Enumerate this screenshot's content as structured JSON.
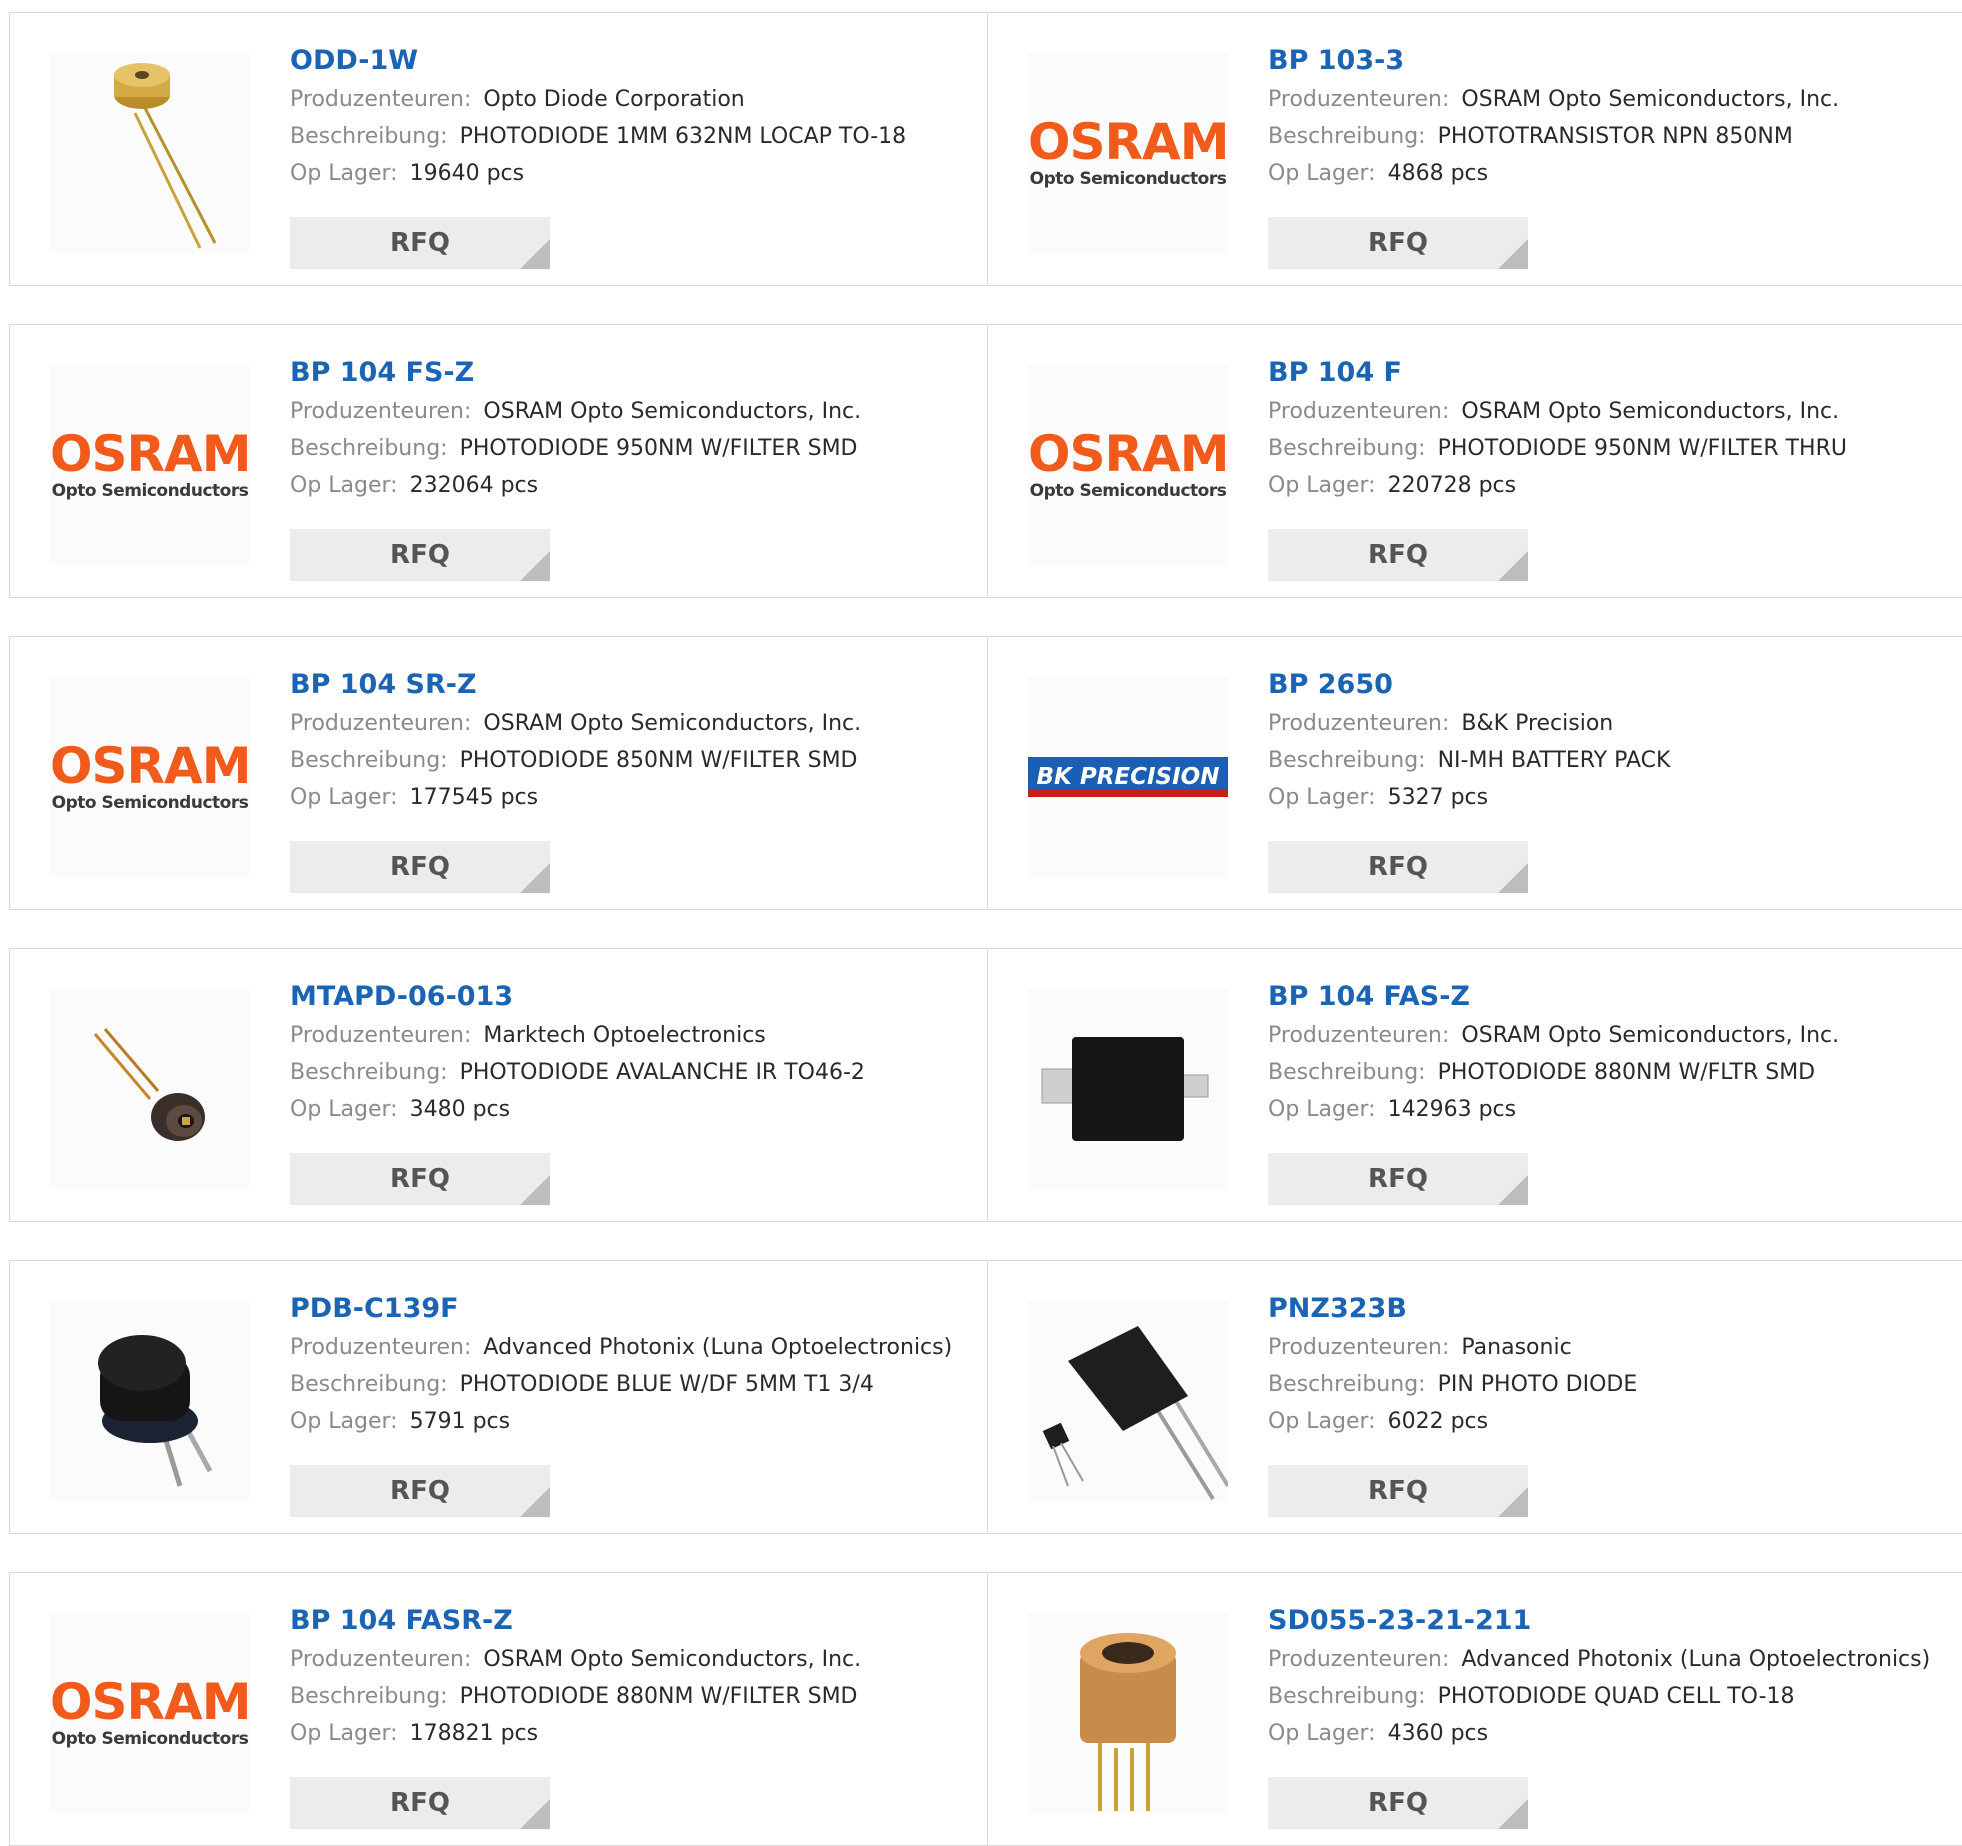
{
  "labels": {
    "manufacturer": "Produzenteuren:",
    "description": "Beschreibung:",
    "stock": "Op Lager:",
    "rfq": "RFQ"
  },
  "colors": {
    "product_link": "#1b64b3",
    "osram_orange": "#f05a1a",
    "rfq_bg": "#ececec"
  },
  "logos": {
    "osram_big": "OSRAM",
    "osram_small": "Opto Semiconductors",
    "bk": "BK PRECISION"
  },
  "products": [
    {
      "name": "ODD-1W",
      "manufacturer": "Opto Diode Corporation",
      "description": "PHOTODIODE 1MM 632NM LOCAP TO-18",
      "stock": "19640 pcs",
      "image": "to18-gold-photodiode"
    },
    {
      "name": "BP 103-3",
      "manufacturer": "OSRAM Opto Semiconductors, Inc.",
      "description": "PHOTOTRANSISTOR NPN 850NM",
      "stock": "4868 pcs",
      "image": "osram-logo"
    },
    {
      "name": "BP 104 FS-Z",
      "manufacturer": "OSRAM Opto Semiconductors, Inc.",
      "description": "PHOTODIODE 950NM W/FILTER SMD",
      "stock": "232064 pcs",
      "image": "osram-logo"
    },
    {
      "name": "BP 104 F",
      "manufacturer": "OSRAM Opto Semiconductors, Inc.",
      "description": "PHOTODIODE 950NM W/FILTER THRU",
      "stock": "220728 pcs",
      "image": "osram-logo"
    },
    {
      "name": "BP 104 SR-Z",
      "manufacturer": "OSRAM Opto Semiconductors, Inc.",
      "description": "PHOTODIODE 850NM W/FILTER SMD",
      "stock": "177545 pcs",
      "image": "osram-logo"
    },
    {
      "name": "BP 2650",
      "manufacturer": "B&K Precision",
      "description": "NI-MH BATTERY PACK",
      "stock": "5327 pcs",
      "image": "bk-precision-logo"
    },
    {
      "name": "MTAPD-06-013",
      "manufacturer": "Marktech Optoelectronics",
      "description": "PHOTODIODE AVALANCHE IR TO46-2",
      "stock": "3480 pcs",
      "image": "to46-photodiode"
    },
    {
      "name": "BP 104 FAS-Z",
      "manufacturer": "OSRAM Opto Semiconductors, Inc.",
      "description": "PHOTODIODE 880NM W/FLTR SMD",
      "stock": "142963 pcs",
      "image": "smd-black-package"
    },
    {
      "name": "PDB-C139F",
      "manufacturer": "Advanced Photonix (Luna Optoelectronics)",
      "description": "PHOTODIODE BLUE W/DF 5MM T1 3/4",
      "stock": "5791 pcs",
      "image": "t1-black-photodiode"
    },
    {
      "name": "PNZ323B",
      "manufacturer": "Panasonic",
      "description": "PIN PHOTO DIODE",
      "stock": "6022 pcs",
      "image": "panasonic-pin-diode"
    },
    {
      "name": "BP 104 FASR-Z",
      "manufacturer": "OSRAM Opto Semiconductors, Inc.",
      "description": "PHOTODIODE 880NM W/FILTER SMD",
      "stock": "178821 pcs",
      "image": "osram-logo"
    },
    {
      "name": "SD055-23-21-211",
      "manufacturer": "Advanced Photonix (Luna Optoelectronics)",
      "description": "PHOTODIODE QUAD CELL TO-18",
      "stock": "4360 pcs",
      "image": "quad-cell-to18"
    }
  ]
}
